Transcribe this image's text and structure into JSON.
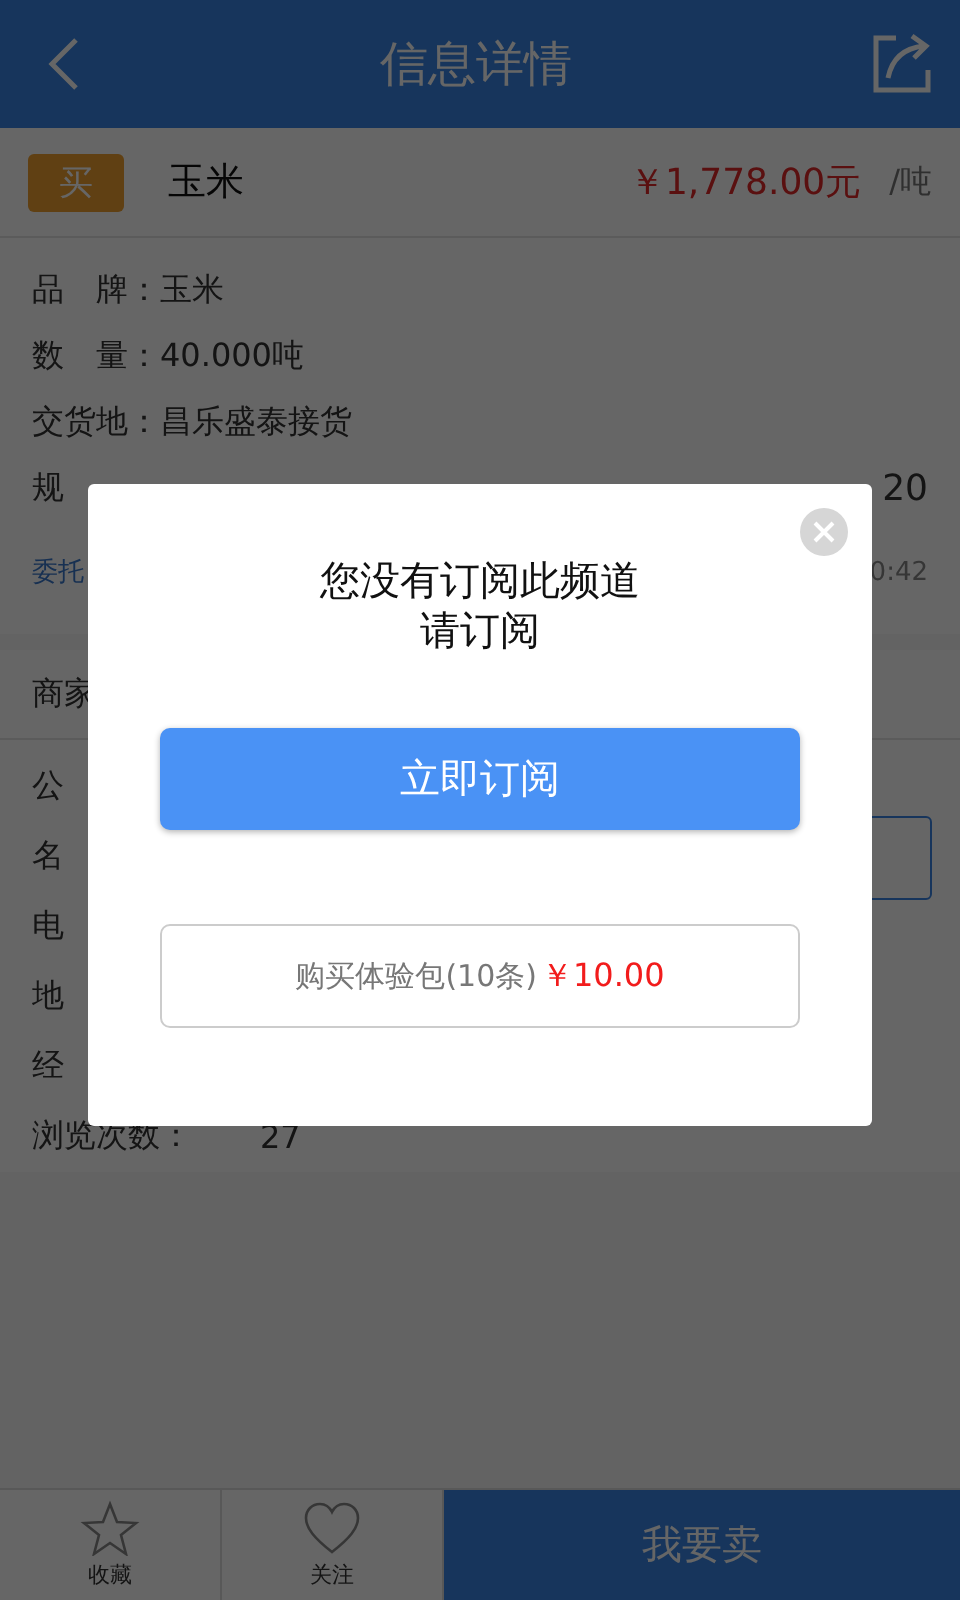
{
  "header": {
    "title": "信息详情"
  },
  "product": {
    "tag": "买",
    "name": "玉米",
    "price": "￥1,778.00元",
    "unit": "/吨"
  },
  "details": [
    {
      "label": "品　牌：",
      "value": "玉米"
    },
    {
      "label": "数　量：",
      "value": "40.000吨"
    },
    {
      "label": "交货地：",
      "value": "昌乐盛泰接货"
    },
    {
      "label": "规",
      "value": "20"
    }
  ],
  "meta": {
    "left": "委托",
    "right": "0:42"
  },
  "merchant": {
    "title": "商家",
    "rows": [
      {
        "label": "公",
        "action": false
      },
      {
        "label": "名",
        "action": true
      },
      {
        "label": "电",
        "action": false
      },
      {
        "label": "地",
        "action": false
      },
      {
        "label": "经",
        "action": false
      },
      {
        "label": "浏览次数：",
        "value": "27",
        "action": false
      }
    ]
  },
  "bottom_bar": {
    "tabs": [
      {
        "label": "收藏"
      },
      {
        "label": "关注"
      }
    ],
    "primary": "我要卖"
  },
  "dialog": {
    "lines": [
      "您没有订阅此频道",
      "请订阅"
    ],
    "primary": "立即订阅",
    "secondary": {
      "label": "购买体验包(10条)",
      "price": "￥10.00"
    }
  }
}
